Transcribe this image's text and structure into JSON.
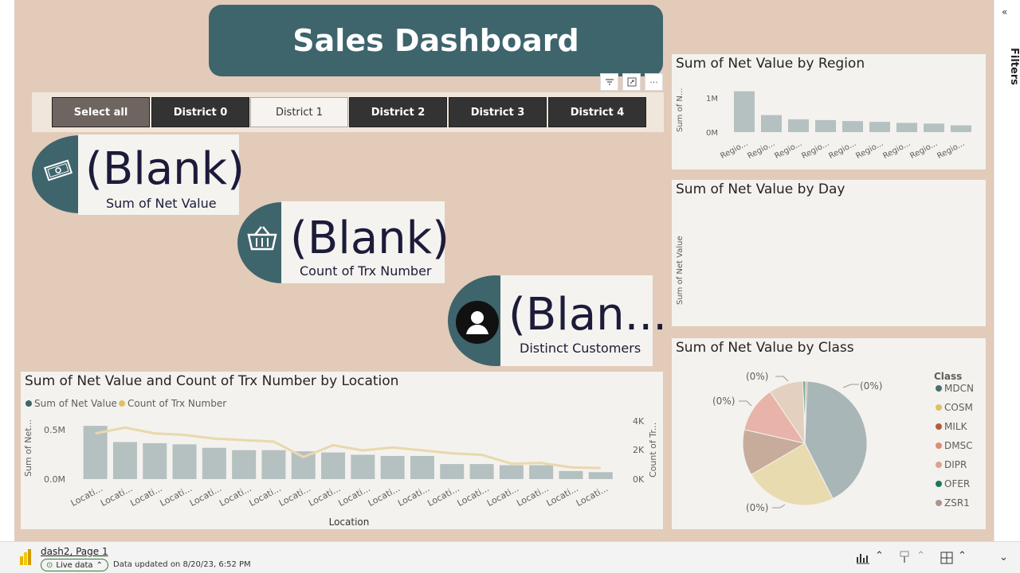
{
  "title": "Sales Dashboard",
  "filters_label": "Filters",
  "slicer": {
    "items": [
      "Select all",
      "District 0",
      "District 1",
      "District 2",
      "District 3",
      "District 4"
    ],
    "selected": "District 1"
  },
  "kpis": [
    {
      "value": "(Blank)",
      "label": "Sum of Net Value",
      "icon": "money-icon"
    },
    {
      "value": "(Blank)",
      "label": "Count of Trx Number",
      "icon": "basket-icon"
    },
    {
      "value": "(Blan...",
      "label": "Distinct Customers",
      "icon": "user-icon"
    }
  ],
  "region_chart": {
    "title": "Sum of Net Value by Region",
    "ylabel": "Sum of N...",
    "yticks": [
      "1M",
      "0M"
    ],
    "chart_data": {
      "type": "bar",
      "categories": [
        "Regio...",
        "Regio...",
        "Regio...",
        "Regio...",
        "Regio...",
        "Regio...",
        "Regio...",
        "Regio...",
        "Regio..."
      ],
      "values": [
        1.15,
        0.48,
        0.36,
        0.34,
        0.31,
        0.29,
        0.26,
        0.24,
        0.19
      ],
      "ylim": [
        0,
        1.3
      ]
    }
  },
  "day_chart": {
    "title": "Sum of Net Value by Day",
    "ylabel": "Sum of Net Value"
  },
  "class_chart": {
    "title": "Sum of Net Value by Class",
    "legend_title": "Class",
    "labels": [
      "(0%)",
      "(0%)",
      "(0%)",
      "(0%)"
    ],
    "chart_data": {
      "type": "pie",
      "categories": [
        "MDCN",
        "COSM",
        "MILK",
        "DMSC",
        "DIPR",
        "OFER",
        "ZSR1"
      ],
      "values": [
        42,
        24,
        12,
        12,
        9,
        0.5,
        0.5
      ],
      "colors": [
        "#a9b6b7",
        "#e8dbb0",
        "#c8ac9b",
        "#e8b3a8",
        "#e4d0bf",
        "#1a7a5e",
        "#b8a89f"
      ]
    },
    "legend_colors": [
      "#4a6d75",
      "#e0c064",
      "#b25d3c",
      "#e08a78",
      "#dba58c",
      "#1a7a5e",
      "#a8978e"
    ]
  },
  "location_chart": {
    "title": "Sum of Net Value and Count of Trx Number by Location",
    "legend": [
      {
        "name": "Sum of Net Value",
        "color": "#3e646c"
      },
      {
        "name": "Count of Trx Number",
        "color": "#e0c064"
      }
    ],
    "xlabel": "Location",
    "ylabel_left": "Sum of Net...",
    "ylabel_right": "Count of Tr...",
    "yticks_left": [
      "0.5M",
      "0.0M"
    ],
    "yticks_right": [
      "4K",
      "2K",
      "0K"
    ],
    "chart_data": {
      "type": "bar",
      "categories": [
        "Locati...",
        "Locati...",
        "Locati...",
        "Locati...",
        "Locati...",
        "Locati...",
        "Locati...",
        "Locati...",
        "Locati...",
        "Locati...",
        "Locati...",
        "Locati...",
        "Locati...",
        "Locati...",
        "Locati...",
        "Locati...",
        "Locati...",
        "Locati..."
      ],
      "series": [
        {
          "name": "Sum of Net Value",
          "values": [
            0.46,
            0.32,
            0.31,
            0.3,
            0.27,
            0.25,
            0.25,
            0.24,
            0.23,
            0.21,
            0.2,
            0.2,
            0.13,
            0.13,
            0.12,
            0.12,
            0.07,
            0.06
          ]
        },
        {
          "name": "Count of Trx Number",
          "values": [
            3100,
            3500,
            3100,
            3000,
            2750,
            2650,
            2550,
            1500,
            2300,
            1950,
            2150,
            1950,
            1750,
            1650,
            1050,
            1100,
            800,
            750
          ]
        }
      ],
      "ylim_left": [
        0,
        0.55
      ],
      "ylim_right": [
        0,
        4000
      ]
    }
  },
  "status": {
    "file": "dash2, Page 1",
    "live": "Live data",
    "updated": "Data updated on 8/20/23, 6:52 PM"
  }
}
